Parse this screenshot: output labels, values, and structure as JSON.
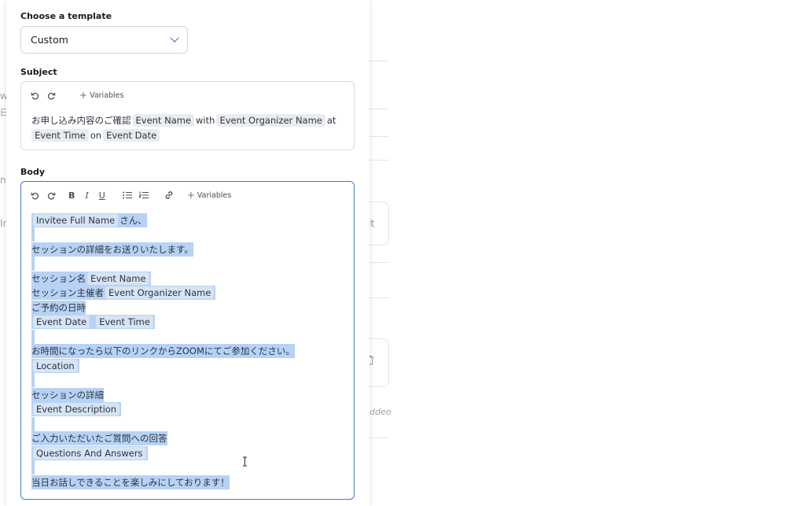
{
  "template": {
    "label": "Choose a template",
    "selected": "Custom"
  },
  "subject": {
    "label": "Subject",
    "variables_label": "Variables",
    "line1": {
      "text": "お申し込み内容のご確認",
      "chip1": "Event Name",
      "with": "with",
      "chip2": "Event Organizer Name",
      "at": "at"
    },
    "line2": {
      "chip1": "Event Time",
      "on": "on",
      "chip2": "Event Date"
    }
  },
  "body": {
    "label": "Body",
    "variables_label": "Variables",
    "toolbar": {
      "bold": "B",
      "italic": "I",
      "underline": "U"
    },
    "lines": {
      "l1_chip": "Invitee Full Name",
      "l1_text": "さん、",
      "l2_text": "セッションの詳細をお送りいたします。",
      "l3_text": "セッション名",
      "l3_chip": "Event Name",
      "l4_text": "セッション主催者",
      "l4_chip": "Event Organizer Name",
      "l5_text": "ご予約の日時",
      "l6_chip1": "Event Date",
      "l6_chip2": "Event Time",
      "l7_text": "お時間になったら以下のリンクからZOOMにてご参加ください。",
      "l8_chip": "Location",
      "l9_text": "セッションの詳細",
      "l10_chip": "Event Description",
      "l11_text": "ご入力いただいたご質問への回答",
      "l12_chip": "Questions And Answers",
      "l13_text": "当日お話しできることを楽しみにしております！"
    }
  },
  "background": {
    "left_w": "w",
    "left_kanji": "曰",
    "left_ne": "ne",
    "left_ir": "Ir",
    "right_it": "it",
    "right_addeo": "ddeo"
  },
  "colors": {
    "accent": "#3b7bd6",
    "selection": "#b7d2f4",
    "chip": "#e9ecef"
  }
}
